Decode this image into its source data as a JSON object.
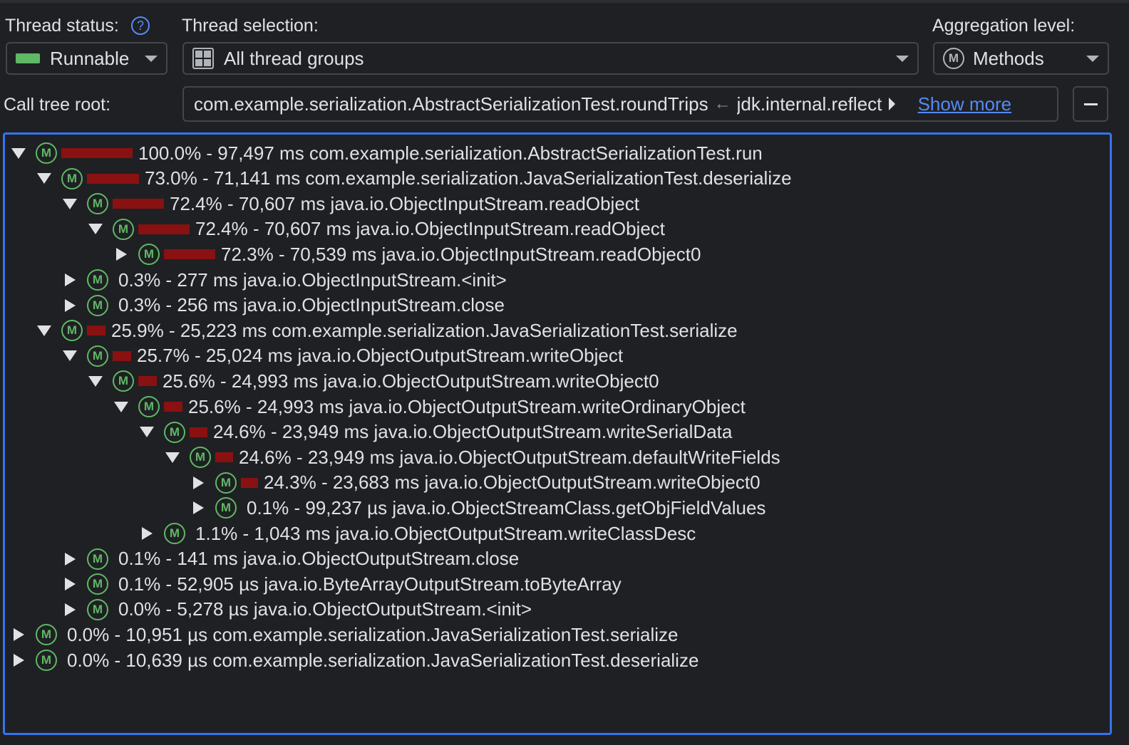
{
  "colors": {
    "background": "#1f2023",
    "accent": "#3574f0",
    "method_icon": "#5fb865",
    "time_bar": "#8a1111",
    "link": "#548af7"
  },
  "thread_status": {
    "label": "Thread status:",
    "help_icon": "question-circle-icon",
    "value": "Runnable",
    "swatch_color": "#5fb865"
  },
  "thread_selection": {
    "label": "Thread selection:",
    "value": "All thread groups",
    "icon": "grid-icon"
  },
  "aggregation": {
    "label": "Aggregation level:",
    "value": "Methods",
    "icon_letter": "M"
  },
  "call_tree_root": {
    "label": "Call tree root:",
    "path": "com.example.serialization.AbstractSerializationTest.roundTrips",
    "arrow": "←",
    "next": "jdk.internal.reflect",
    "show_more": "Show more",
    "collapse_icon": "minus-icon"
  },
  "tree": {
    "icon_letter": "M",
    "rows": [
      {
        "text": "100.0% - 97,497 ms com.example.serialization.AbstractSerializationTest.run",
        "depth": 0,
        "state": "open",
        "percent": 100.0
      },
      {
        "text": "73.0% - 71,141 ms com.example.serialization.JavaSerializationTest.deserialize",
        "depth": 1,
        "state": "open",
        "percent": 73.0
      },
      {
        "text": "72.4% - 70,607 ms java.io.ObjectInputStream.readObject",
        "depth": 2,
        "state": "open",
        "percent": 72.4
      },
      {
        "text": "72.4% - 70,607 ms java.io.ObjectInputStream.readObject",
        "depth": 3,
        "state": "open",
        "percent": 72.4
      },
      {
        "text": "72.3% - 70,539 ms java.io.ObjectInputStream.readObject0",
        "depth": 4,
        "state": "closed",
        "percent": 72.3
      },
      {
        "text": "0.3% - 277 ms java.io.ObjectInputStream.<init>",
        "depth": 2,
        "state": "closed",
        "percent": 0.3
      },
      {
        "text": "0.3% - 256 ms java.io.ObjectInputStream.close",
        "depth": 2,
        "state": "closed",
        "percent": 0.3
      },
      {
        "text": "25.9% - 25,223 ms com.example.serialization.JavaSerializationTest.serialize",
        "depth": 1,
        "state": "open",
        "percent": 25.9
      },
      {
        "text": "25.7% - 25,024 ms java.io.ObjectOutputStream.writeObject",
        "depth": 2,
        "state": "open",
        "percent": 25.7
      },
      {
        "text": "25.6% - 24,993 ms java.io.ObjectOutputStream.writeObject0",
        "depth": 3,
        "state": "open",
        "percent": 25.6
      },
      {
        "text": "25.6% - 24,993 ms java.io.ObjectOutputStream.writeOrdinaryObject",
        "depth": 4,
        "state": "open",
        "percent": 25.6
      },
      {
        "text": "24.6% - 23,949 ms java.io.ObjectOutputStream.writeSerialData",
        "depth": 5,
        "state": "open",
        "percent": 24.6
      },
      {
        "text": "24.6% - 23,949 ms java.io.ObjectOutputStream.defaultWriteFields",
        "depth": 6,
        "state": "open",
        "percent": 24.6
      },
      {
        "text": "24.3% - 23,683 ms java.io.ObjectOutputStream.writeObject0",
        "depth": 7,
        "state": "closed",
        "percent": 24.3
      },
      {
        "text": "0.1% - 99,237 µs java.io.ObjectStreamClass.getObjFieldValues",
        "depth": 7,
        "state": "closed",
        "percent": 0.1
      },
      {
        "text": "1.1% - 1,043 ms java.io.ObjectOutputStream.writeClassDesc",
        "depth": 5,
        "state": "closed",
        "percent": 1.1
      },
      {
        "text": "0.1% - 141 ms java.io.ObjectOutputStream.close",
        "depth": 2,
        "state": "closed",
        "percent": 0.1
      },
      {
        "text": "0.1% - 52,905 µs java.io.ByteArrayOutputStream.toByteArray",
        "depth": 2,
        "state": "closed",
        "percent": 0.1
      },
      {
        "text": "0.0% - 5,278 µs java.io.ObjectOutputStream.<init>",
        "depth": 2,
        "state": "closed",
        "percent": 0.0
      },
      {
        "text": "0.0% - 10,951 µs com.example.serialization.JavaSerializationTest.serialize",
        "depth": 0,
        "state": "closed",
        "percent": 0.0
      },
      {
        "text": "0.0% - 10,639 µs com.example.serialization.JavaSerializationTest.deserialize",
        "depth": 0,
        "state": "closed",
        "percent": 0.0
      }
    ]
  }
}
